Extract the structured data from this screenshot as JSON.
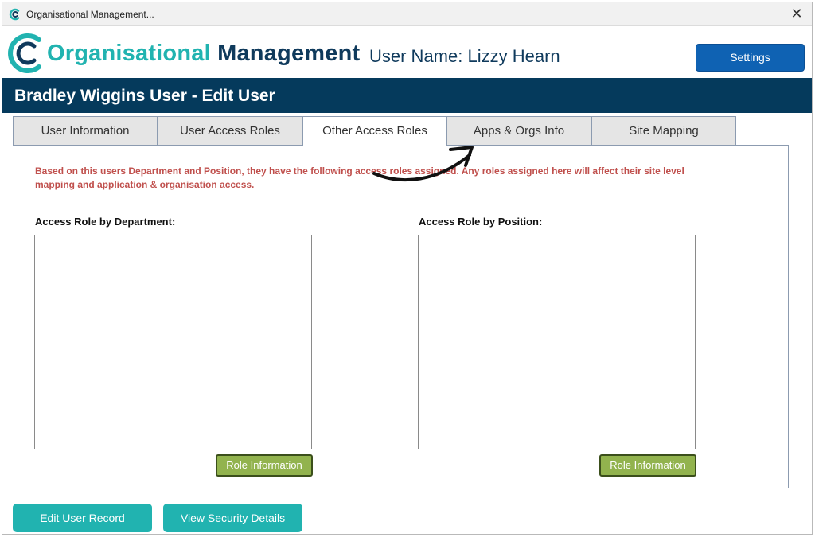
{
  "window": {
    "title": "Organisational Management...",
    "close_symbol": "✕"
  },
  "brand": {
    "word1": "Organisational",
    "word2": "Management",
    "username": "User Name: Lizzy Hearn",
    "colors": {
      "teal": "#21b3b0",
      "navy": "#0f3a5c"
    }
  },
  "toolbar": {
    "settings_label": "Settings"
  },
  "header": {
    "title": "Bradley Wiggins User - Edit User"
  },
  "tabs": [
    {
      "label": "User Information"
    },
    {
      "label": "User Access Roles"
    },
    {
      "label": "Other Access Roles"
    },
    {
      "label": "Apps & Orgs Info"
    },
    {
      "label": "Site Mapping"
    }
  ],
  "active_tab": "Other Access Roles",
  "content": {
    "note": "Based on this users Department and Position, they have the following access roles assigned. Any roles assigned here will affect their site level mapping and application & organisation access.",
    "department": {
      "label": "Access Role by Department:",
      "button": "Role Information"
    },
    "position": {
      "label": "Access Role by Position:",
      "button": "Role Information"
    }
  },
  "footer": {
    "edit_label": "Edit User Record",
    "security_label": "View Security Details"
  },
  "icons": {
    "app_icon": "logo-c-icon",
    "close": "close-icon",
    "annotation": "curved-arrow-icon"
  }
}
